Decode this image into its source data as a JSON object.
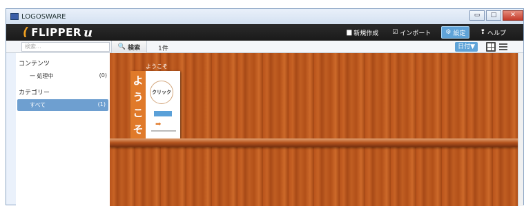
{
  "window": {
    "title": "LOGOSWARE",
    "min_label": "▭",
    "max_label": "□",
    "close_label": "✕"
  },
  "app": {
    "logo_text": "FLIPPER",
    "logo_suffix": "u",
    "logo_swoosh": "(",
    "menu": [
      {
        "icon": "▆",
        "label": "新規作成"
      },
      {
        "icon": "☑",
        "label": "インポート"
      },
      {
        "icon": "⚙",
        "label": "設定"
      },
      {
        "icon": "❢",
        "label": "ヘルプ"
      }
    ]
  },
  "toolbar": {
    "search_placeholder": "検索...",
    "search_button": "検索",
    "search_icon": "🔍",
    "count": "1件",
    "sort_label": "日付▼"
  },
  "sidebar": {
    "contents_title": "コンテンツ",
    "processing_label": "一 処理中",
    "processing_count": "(0)",
    "category_title": "カテゴリー",
    "all_label": "すべて",
    "all_count": "(1)"
  },
  "book": {
    "caption": "ようこそ",
    "side_chars": [
      "よ",
      "う",
      "こ",
      "そ"
    ],
    "click_label": "クリック"
  },
  "colors": {
    "accent": "#5fa3d8",
    "shelf": "#b9541c",
    "book_orange": "#e07a2a"
  }
}
